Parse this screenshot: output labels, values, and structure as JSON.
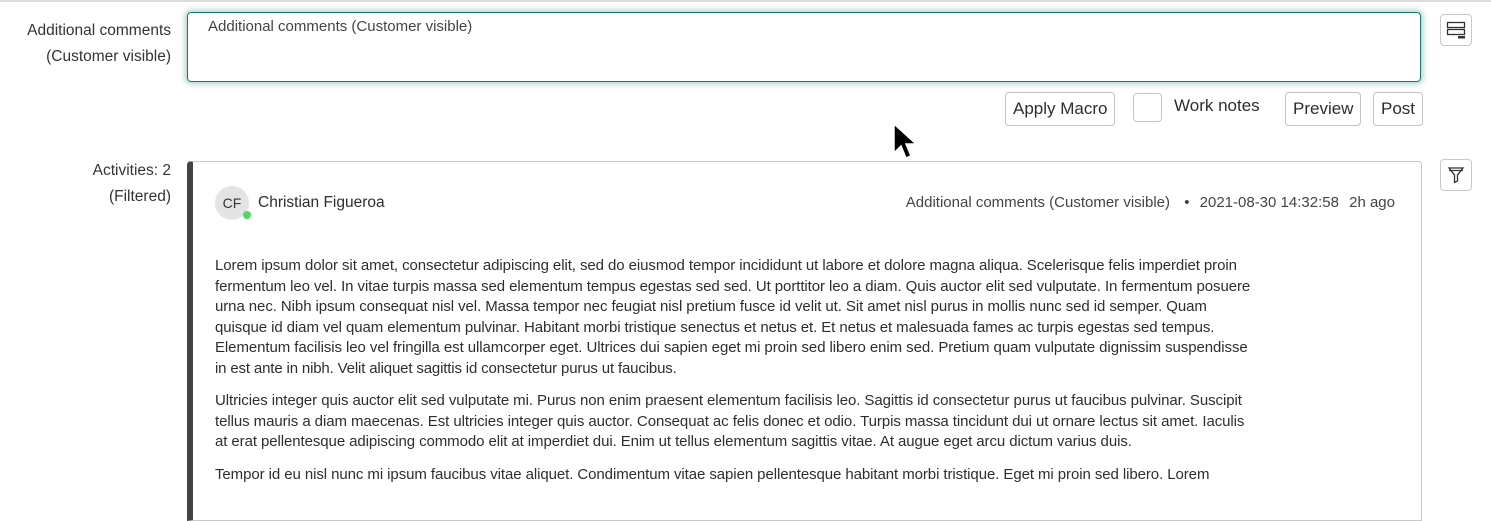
{
  "form": {
    "comments_label_1": "Additional comments",
    "comments_label_2": "(Customer visible)",
    "comments_placeholder": "Additional comments (Customer visible)",
    "apply_macro": "Apply Macro",
    "work_notes": "Work notes",
    "work_notes_checked": false,
    "preview": "Preview",
    "post": "Post"
  },
  "activities": {
    "label_1": "Activities: 2",
    "label_2": "(Filtered)",
    "entry": {
      "initials": "CF",
      "author": "Christian Figueroa",
      "field": "Additional comments (Customer visible)",
      "separator": "•",
      "timestamp": "2021-08-30 14:32:58",
      "relative": "2h ago",
      "paragraphs": [
        [
          "Lorem ipsum dolor sit amet, consectetur adipiscing elit, sed do eiusmod tempor incididunt ut labore et dolore magna aliqua. Scelerisque felis imperdiet proin",
          "fermentum leo vel. In vitae turpis massa sed elementum tempus egestas sed sed. Ut porttitor leo a diam. Quis auctor elit sed vulputate. In fermentum posuere",
          "urna nec. Nibh ipsum consequat nisl vel. Massa tempor nec feugiat nisl pretium fusce id velit ut. Sit amet nisl purus in mollis nunc sed id semper. Quam",
          "quisque id diam vel quam elementum pulvinar. Habitant morbi tristique senectus et netus et. Et netus et malesuada fames ac turpis egestas sed tempus.",
          "Elementum facilisis leo vel fringilla est ullamcorper eget. Ultrices dui sapien eget mi proin sed libero enim sed. Pretium quam vulputate dignissim suspendisse",
          "in est ante in nibh. Velit aliquet sagittis id consectetur purus ut faucibus."
        ],
        [
          "Ultricies integer quis auctor elit sed vulputate mi. Purus non enim praesent elementum facilisis leo. Sagittis id consectetur purus ut faucibus pulvinar. Suscipit",
          "tellus mauris a diam maecenas. Est ultricies integer quis auctor. Consequat ac felis donec et odio. Turpis massa tincidunt dui ut ornare lectus sit amet. Iaculis",
          "at erat pellentesque adipiscing commodo elit at imperdiet dui. Enim ut tellus elementum sagittis vitae. At augue eget arcu dictum varius duis."
        ],
        [
          "Tempor id eu nisl nunc mi ipsum faucibus vitae aliquet. Condimentum vitae sapien pellentesque habitant morbi tristique. Eget mi proin sed libero. Lorem"
        ]
      ]
    }
  },
  "colors": {
    "focus": "#1d7a6a",
    "online": "#4cd964",
    "accent_bar": "#444444"
  }
}
